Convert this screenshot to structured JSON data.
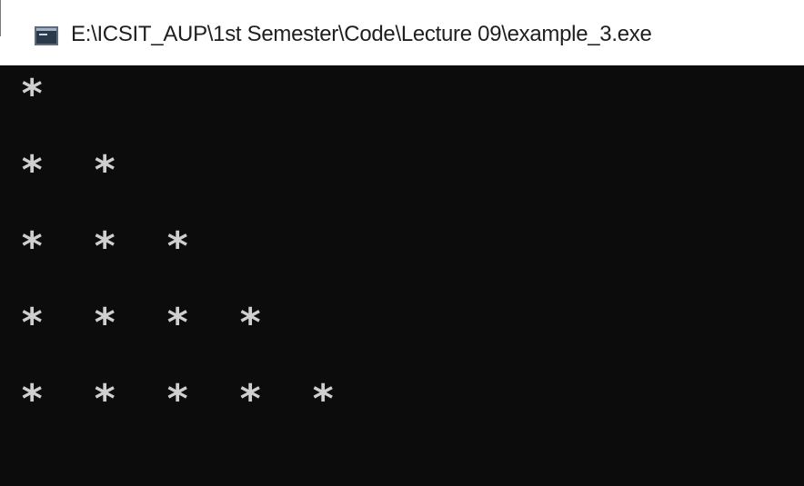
{
  "window": {
    "title": "E:\\ICSIT_AUP\\1st Semester\\Code\\Lecture 09\\example_3.exe",
    "icon": "console-app-icon"
  },
  "console": {
    "background": "#0c0c0c",
    "text_color": "#cfcfcf",
    "lines": [
      "*",
      "* *",
      "* * *",
      "* * * *",
      "* * * * *"
    ]
  }
}
